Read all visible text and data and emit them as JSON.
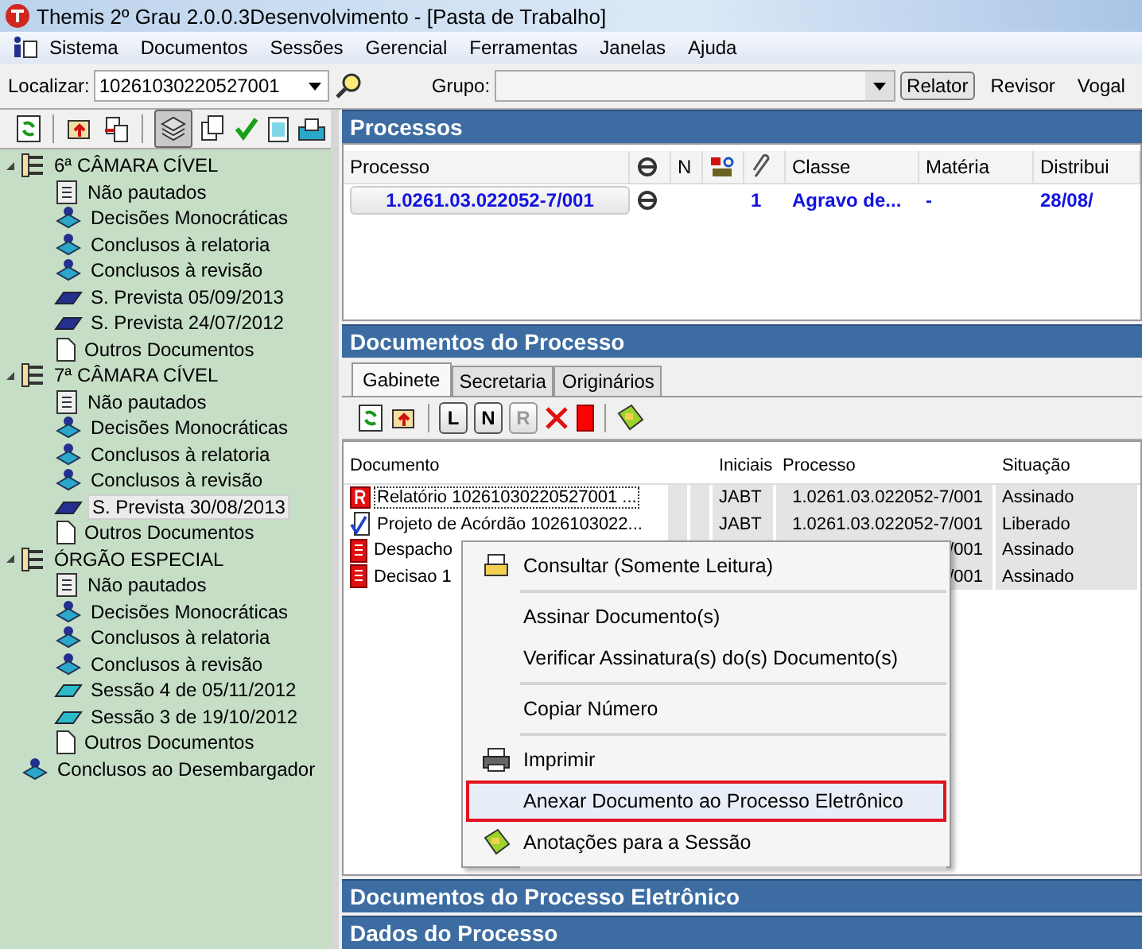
{
  "window": {
    "title": "Themis 2º Grau 2.0.0.3Desenvolvimento - [Pasta de Trabalho]"
  },
  "menu": [
    "Sistema",
    "Documentos",
    "Sessões",
    "Gerencial",
    "Ferramentas",
    "Janelas",
    "Ajuda"
  ],
  "search_bar": {
    "label": "Localizar:",
    "value": "10261030220527001",
    "group_label": "Grupo:",
    "roles": [
      {
        "label": "Relator",
        "selected": true
      },
      {
        "label": "Revisor",
        "selected": false
      },
      {
        "label": "Vogal",
        "selected": false
      }
    ]
  },
  "tree": [
    {
      "label": "6ª CÂMARA CÍVEL",
      "kind": "group",
      "expanded": true,
      "selected": false,
      "children": [
        {
          "label": "Não pautados",
          "kind": "list",
          "selected": false
        },
        {
          "label": "Decisões Monocráticas",
          "kind": "stack",
          "selected": false
        },
        {
          "label": "Conclusos à relatoria",
          "kind": "stack",
          "selected": false
        },
        {
          "label": "Conclusos à revisão",
          "kind": "stack",
          "selected": false
        },
        {
          "label": "S. Prevista 05/09/2013",
          "kind": "session",
          "selected": false
        },
        {
          "label": "S. Prevista 24/07/2012",
          "kind": "session",
          "selected": false
        },
        {
          "label": "Outros Documentos",
          "kind": "doc",
          "selected": false
        }
      ]
    },
    {
      "label": "7ª CÂMARA CÍVEL",
      "kind": "group",
      "expanded": true,
      "selected": false,
      "children": [
        {
          "label": "Não pautados",
          "kind": "list",
          "selected": false
        },
        {
          "label": "Decisões Monocráticas",
          "kind": "stack",
          "selected": false
        },
        {
          "label": "Conclusos à relatoria",
          "kind": "stack",
          "selected": false
        },
        {
          "label": "Conclusos à revisão",
          "kind": "stack",
          "selected": false
        },
        {
          "label": "S. Prevista 30/08/2013",
          "kind": "session",
          "selected": true
        },
        {
          "label": "Outros Documentos",
          "kind": "doc",
          "selected": false
        }
      ]
    },
    {
      "label": "ÓRGÃO ESPECIAL",
      "kind": "group",
      "expanded": true,
      "selected": false,
      "children": [
        {
          "label": "Não pautados",
          "kind": "list",
          "selected": false
        },
        {
          "label": "Decisões Monocráticas",
          "kind": "stack",
          "selected": false
        },
        {
          "label": "Conclusos à relatoria",
          "kind": "stack",
          "selected": false
        },
        {
          "label": "Conclusos à revisão",
          "kind": "stack",
          "selected": false
        },
        {
          "label": "Sessão 4 de 05/11/2012",
          "kind": "held",
          "selected": false
        },
        {
          "label": "Sessão 3 de 19/10/2012",
          "kind": "held",
          "selected": false
        },
        {
          "label": "Outros Documentos",
          "kind": "doc",
          "selected": false
        }
      ]
    },
    {
      "label": "Conclusos ao Desembargador",
      "kind": "stack",
      "selected": false
    }
  ],
  "processos": {
    "title": "Processos",
    "columns": [
      "Processo",
      "N",
      "Classe",
      "Matéria",
      "Distribui"
    ],
    "rows": [
      {
        "processo": "1.0261.03.022052-7/001",
        "count": "1",
        "classe": "Agravo de...",
        "materia": "-",
        "distribuicao": "28/08/"
      }
    ]
  },
  "documentos": {
    "title": "Documentos do Processo",
    "tabs": [
      {
        "label": "Gabinete",
        "selected": true
      },
      {
        "label": "Secretaria",
        "selected": false
      },
      {
        "label": "Originários",
        "selected": false
      }
    ],
    "filters": [
      {
        "label": "L",
        "disabled": false
      },
      {
        "label": "N",
        "disabled": false
      },
      {
        "label": "R",
        "disabled": true
      }
    ],
    "columns": [
      "Documento",
      "Iniciais",
      "Processo",
      "Situação"
    ],
    "rows": [
      {
        "kind": "report",
        "documento": "Relatório 10261030220527001 ...",
        "iniciais": "JABT",
        "processo": "1.0261.03.022052-7/001",
        "situacao": "Assinado",
        "selected": true
      },
      {
        "kind": "signed",
        "documento": "Projeto de Acórdão 1026103022...",
        "iniciais": "JABT",
        "processo": "1.0261.03.022052-7/001",
        "situacao": "Liberado",
        "selected": false
      },
      {
        "kind": "ruled",
        "documento": "Despacho",
        "processo": "/001",
        "situacao": "Assinado",
        "selected": false
      },
      {
        "kind": "ruled",
        "documento": "Decisao 1",
        "processo": "/001",
        "situacao": "Assinado",
        "selected": false
      }
    ]
  },
  "context_menu": [
    {
      "label": "Consultar (Somente Leitura)",
      "kind": "viewer",
      "separator_after": true,
      "highlighted": false
    },
    {
      "label": "Assinar Documento(s)",
      "kind": "plain",
      "separator_after": false,
      "highlighted": false
    },
    {
      "label": "Verificar Assinatura(s) do(s) Documento(s)",
      "kind": "plain",
      "separator_after": true,
      "highlighted": false
    },
    {
      "label": "Copiar Número",
      "kind": "plain",
      "separator_after": true,
      "highlighted": false
    },
    {
      "label": "Imprimir",
      "kind": "printer",
      "separator_after": false,
      "highlighted": false
    },
    {
      "label": "Anexar Documento ao Processo Eletrônico",
      "kind": "plain",
      "separator_after": false,
      "highlighted": true
    },
    {
      "label": "Anotações para a Sessão",
      "kind": "note",
      "separator_after": true,
      "highlighted": false
    }
  ],
  "bottom_panels": [
    "Documentos do Processo Eletrônico",
    "Dados do Processo"
  ]
}
